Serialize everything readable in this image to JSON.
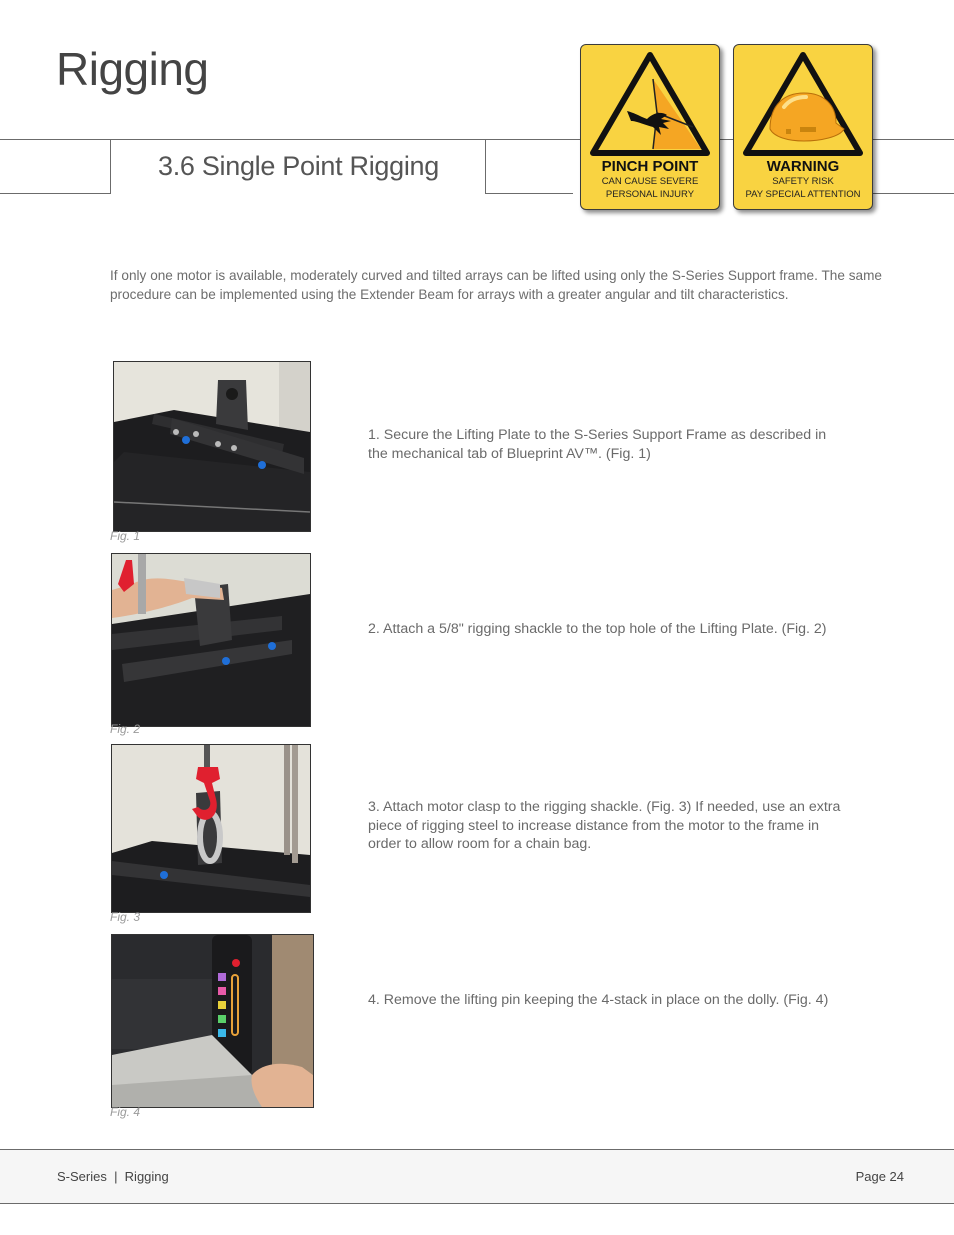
{
  "header": {
    "page_title": "Rigging",
    "section_title": "3.6 Single Point Rigging"
  },
  "signs": [
    {
      "icon": "pinch-point-icon",
      "heading": "PINCH POINT",
      "line1": "CAN CAUSE SEVERE",
      "line2": "PERSONAL INJURY"
    },
    {
      "icon": "hard-hat-icon",
      "heading": "WARNING",
      "line1": "SAFETY RISK",
      "line2": "PAY SPECIAL ATTENTION"
    }
  ],
  "intro": "If only one motor is available, moderately curved and tilted arrays can be lifted using only the S-Series Support frame.  The same procedure can be implemented using the Extender Beam for arrays with a greater angular and tilt characteristics.",
  "steps": [
    {
      "figure_caption": "Fig. 1",
      "photo": "lifting-plate-on-support-frame",
      "text": "1. Secure the Lifting Plate to the S-Series Support Frame as described in the mechanical tab of Blueprint AV™. (Fig. 1)"
    },
    {
      "figure_caption": "Fig. 2",
      "photo": "attaching-shackle-to-lifting-plate",
      "text": "2. Attach a 5/8\" rigging shackle to the top hole of the Lifting Plate. (Fig. 2)"
    },
    {
      "figure_caption": "Fig. 3",
      "photo": "motor-hook-on-shackle",
      "text": "3. Attach motor clasp to the rigging shackle. (Fig. 3) If needed, use an extra piece of rigging steel to increase distance from the motor to the frame in order to allow room for a chain bag."
    },
    {
      "figure_caption": "Fig. 4",
      "photo": "removing-lifting-pin-on-dolly",
      "text": "4. Remove the lifting pin keeping the 4-stack in place on the dolly. (Fig. 4)"
    }
  ],
  "footer": {
    "left": "S-Series  |  Rigging",
    "right": "Page 24"
  },
  "colors": {
    "sign_yellow": "#f9d341",
    "sign_orange": "#f5a623",
    "hook_red": "#e0202f",
    "connector_blue": "#1f6fd8"
  }
}
